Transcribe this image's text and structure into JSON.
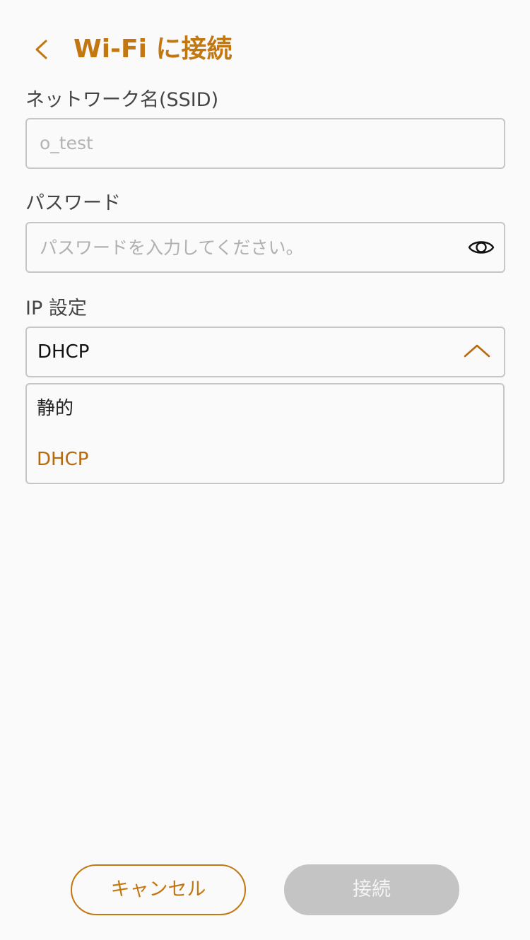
{
  "header": {
    "title": "Wi-Fi に接続",
    "back_icon": "chevron-left-icon"
  },
  "ssid": {
    "label": "ネットワーク名(SSID)",
    "value": "o_test"
  },
  "password": {
    "label": "パスワード",
    "placeholder": "パスワードを入力してください。",
    "value": "",
    "toggle_icon": "eye-icon"
  },
  "ip_settings": {
    "label": "IP 設定",
    "selected": "DHCP",
    "expanded": true,
    "options": [
      {
        "label": "静的",
        "selected": false
      },
      {
        "label": "DHCP",
        "selected": true
      }
    ]
  },
  "footer": {
    "cancel_label": "キャンセル",
    "connect_label": "接続",
    "connect_enabled": false
  },
  "colors": {
    "accent": "#c27710",
    "disabled_button": "#c4c4c4",
    "border": "#c6c6c6",
    "background": "#fafafa"
  }
}
